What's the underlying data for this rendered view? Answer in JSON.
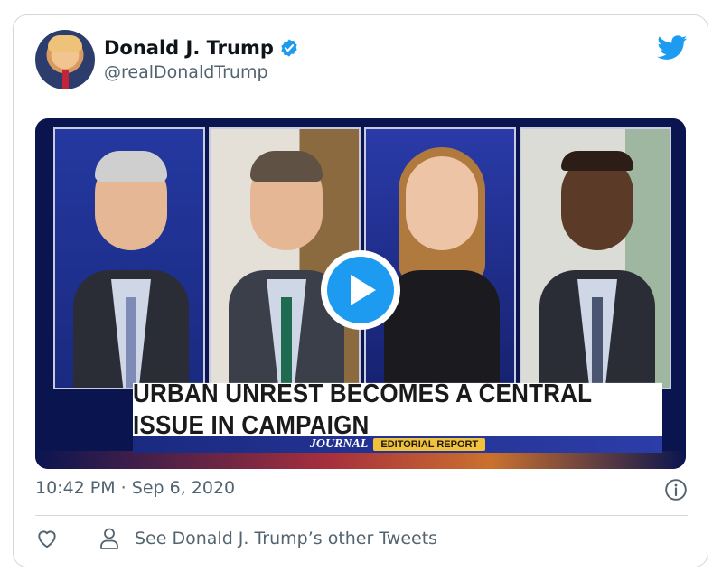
{
  "tweet": {
    "author_name": "Donald J. Trump",
    "handle": "@realDonaldTrump",
    "timestamp": "10:42 PM · Sep 6, 2020",
    "other_tweets_label": "See Donald J. Trump’s other Tweets"
  },
  "media": {
    "chyron": "URBAN UNREST BECOMES A CENTRAL ISSUE IN CAMPAIGN",
    "journal_label": "JOURNAL",
    "editorial_label": "EDITORIAL REPORT"
  },
  "icons": {
    "verified": "verified-badge-icon",
    "brand": "twitter-bird-icon",
    "play": "play-icon",
    "info": "info-icon",
    "like": "heart-icon",
    "profile": "person-icon"
  },
  "colors": {
    "accent": "#1d9bf0",
    "text_secondary": "#536471",
    "border": "#cfd9de"
  }
}
